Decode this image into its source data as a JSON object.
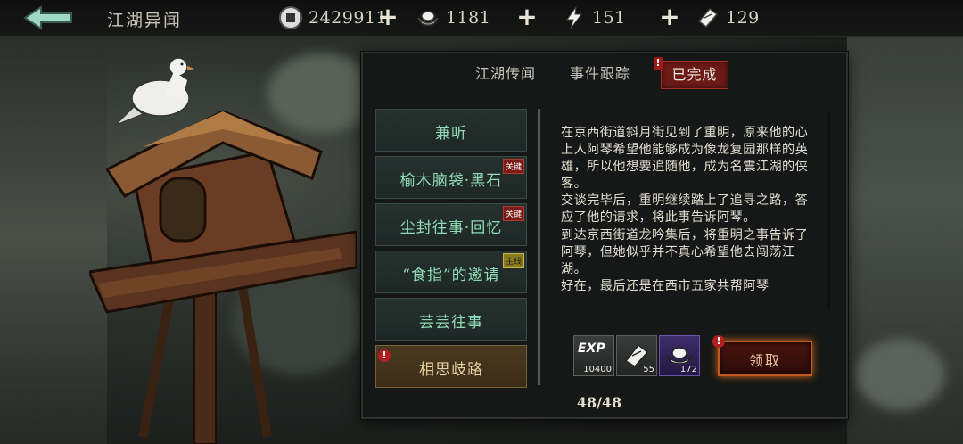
{
  "header": {
    "title": "江湖异闻",
    "resources": [
      {
        "name": "coin",
        "icon": "coin-icon",
        "value": "2429911"
      },
      {
        "name": "silver",
        "icon": "silver-ingot-icon",
        "value": "1181"
      },
      {
        "name": "stamina",
        "icon": "lightning-icon",
        "value": "151"
      },
      {
        "name": "ticket",
        "icon": "ticket-icon",
        "value": "129"
      }
    ]
  },
  "tabs": [
    {
      "label": "江湖传闻",
      "active": false
    },
    {
      "label": "事件跟踪",
      "active": false
    },
    {
      "label": "已完成",
      "active": true
    }
  ],
  "events": [
    {
      "label": "兼听",
      "tag": ""
    },
    {
      "label": "榆木脑袋·黑石",
      "tag": "关键"
    },
    {
      "label": "尘封往事·回忆",
      "tag": "关键"
    },
    {
      "label": "“食指”的邀请",
      "tag": "主线"
    },
    {
      "label": "芸芸往事",
      "tag": ""
    },
    {
      "label": "相思歧路",
      "tag": "",
      "selected": true
    }
  ],
  "detail": {
    "paragraphs": [
      "在京西街道斜月街见到了重明，原来他的心上人阿琴希望他能够成为像龙复园那样的英雄，所以他想要追随他，成为名震江湖的侠客。",
      "交谈完毕后，重明继续踏上了追寻之路，答应了他的请求，将此事告诉阿琴。",
      "到达京西街道龙吟集后，将重明之事告诉了阿琴，但她似乎并不真心希望他去闯荡江湖。",
      "好在，最后还是在西市五家共帮阿琴"
    ]
  },
  "rewards": [
    {
      "icon": "exp-icon",
      "label": "EXP",
      "count": "10400"
    },
    {
      "icon": "ticket-icon",
      "count": "55"
    },
    {
      "icon": "silver-ingot-icon",
      "count": "172"
    }
  ],
  "claim_label": "领取",
  "pager": "48/48",
  "colors": {
    "accent_red": "#6b1a16",
    "list_text": "#8fd9b8",
    "selected_item": "#4a3a22",
    "claim_glow": "#d86a22"
  }
}
